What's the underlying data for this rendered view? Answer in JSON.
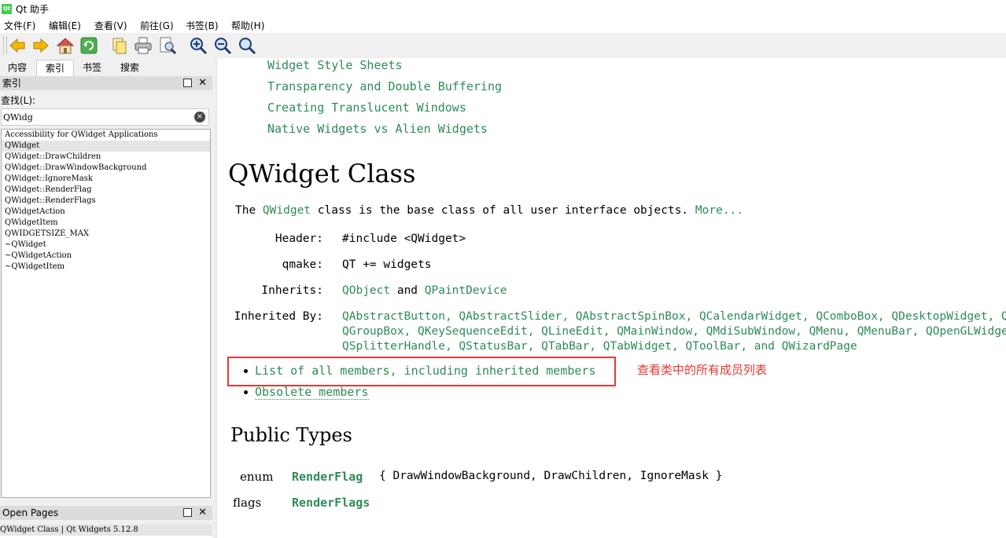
{
  "window": {
    "title": "Qt 助手",
    "icon_label": "Qt"
  },
  "menu": [
    "文件(F)",
    "编辑(E)",
    "查看(V)",
    "前往(G)",
    "书签(B)",
    "帮助(H)"
  ],
  "toolbar": {
    "buttons": [
      "back-icon",
      "forward-icon",
      "home-icon",
      "sync-icon",
      "copy-icon",
      "print-icon",
      "find-icon",
      "zoom-in-icon",
      "zoom-out-icon",
      "zoom-reset-icon"
    ]
  },
  "sidebar": {
    "tabs": [
      "内容",
      "索引",
      "书签",
      "搜索"
    ],
    "active_tab": "索引",
    "index_dock_title": "索引",
    "find_label": "查找(L):",
    "search_value": "QWidg",
    "clear_symbol": "×",
    "items": [
      "Accessibility for QWidget Applications",
      "QWidget",
      "QWidget::DrawChildren",
      "QWidget::DrawWindowBackground",
      "QWidget::IgnoreMask",
      "QWidget::RenderFlag",
      "QWidget::RenderFlags",
      "QWidgetAction",
      "QWidgetItem",
      "QWIDGETSIZE_MAX",
      "~QWidget",
      "~QWidgetAction",
      "~QWidgetItem"
    ],
    "selected_item": "QWidget",
    "open_pages_title": "Open Pages",
    "open_pages": [
      "QWidget Class | Qt Widgets 5.12.8"
    ],
    "dock_close_symbol": "✕"
  },
  "doc": {
    "toc_links": [
      "Widget Style Sheets",
      "Transparency and Double Buffering",
      "Creating Translucent Windows",
      "Native Widgets vs Alien Widgets"
    ],
    "class_title": "QWidget Class",
    "brief": {
      "prefix": "The ",
      "link": "QWidget",
      "suffix": " class is the base class of all user interface objects. ",
      "more": "More..."
    },
    "header_label": "Header:",
    "header_value": "#include <QWidget>",
    "qmake_label": "qmake:",
    "qmake_value": "QT += widgets",
    "inherits_label": "Inherits:",
    "inherits": {
      "a": "QObject",
      "and": " and ",
      "b": "QPaintDevice"
    },
    "inherited_by_label": "Inherited By:",
    "inherited_by_lines": [
      "QAbstractButton, QAbstractSlider, QAbstractSpinBox, QCalendarWidget, QComboBox, QDesktopWidget, QDial",
      "QGroupBox, QKeySequenceEdit, QLineEdit, QMainWindow, QMdiSubWindow, QMenu, QMenuBar, QOpenGLWidget",
      "QSplitterHandle, QStatusBar, QTabBar, QTabWidget, QToolBar, and QWizardPage"
    ],
    "member_links": [
      "List of all members, including inherited members",
      "Obsolete members"
    ],
    "annotation": "查看类中的所有成员列表",
    "public_types_title": "Public Types",
    "public_types": [
      {
        "kind": "enum",
        "name": "RenderFlag",
        "rest": "{ DrawWindowBackground, DrawChildren, IgnoreMask }"
      },
      {
        "kind": "flags",
        "name": "RenderFlags",
        "rest": ""
      }
    ]
  },
  "colors": {
    "link": "#2e8b57",
    "annotation": "#e53935",
    "toolbar_bg": "#f0f0f0"
  }
}
